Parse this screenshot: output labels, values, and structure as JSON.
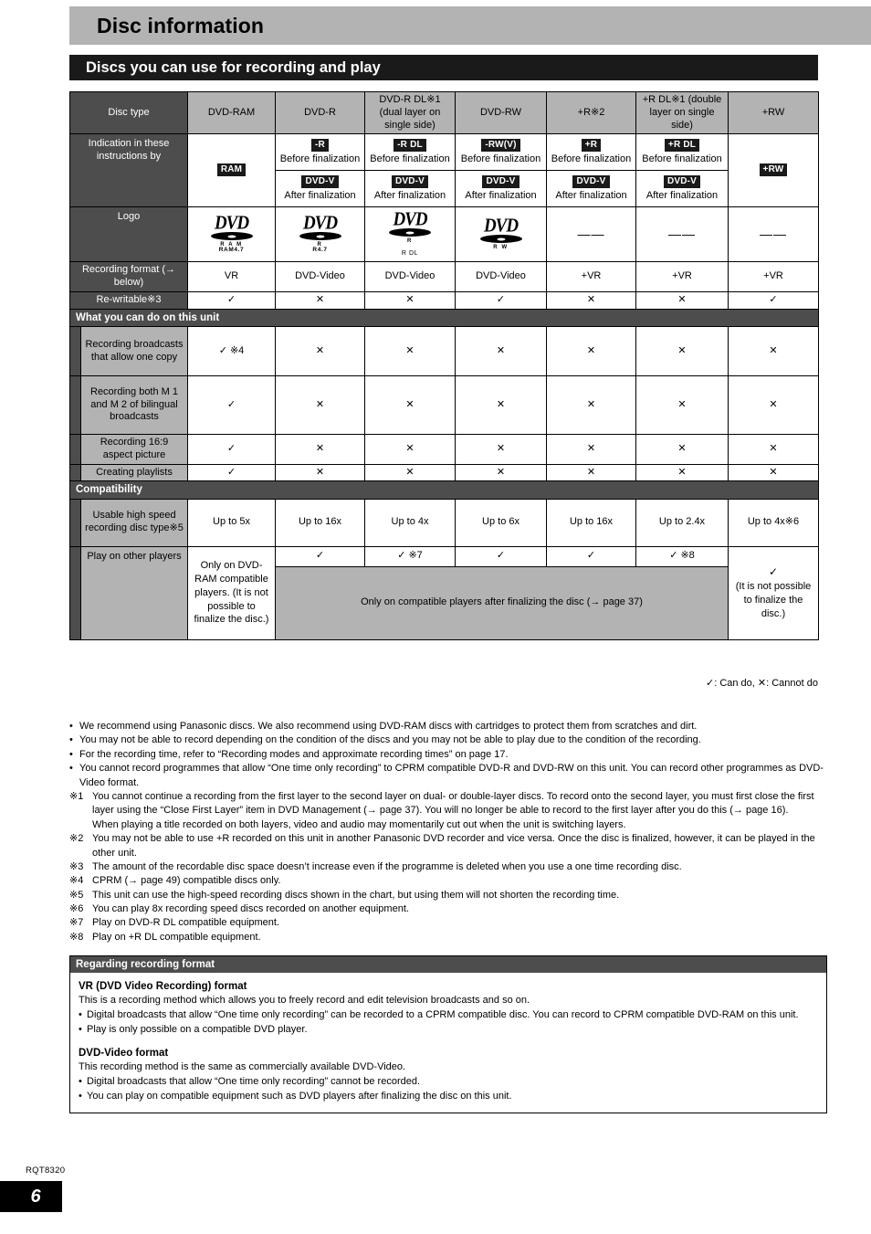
{
  "page": {
    "title": "Disc information",
    "section_title": "Discs you can use for recording and play",
    "doc_code": "RQT8320",
    "page_number": "6"
  },
  "table": {
    "row_labels": {
      "disc_type": "Disc type",
      "indication": "Indication in these instructions by",
      "logo": "Logo",
      "recording_format": "Recording format (→ below)",
      "rewritable": "Re-writable※3",
      "band_what_you_can_do": "What you can do on this unit",
      "rec_one_copy": "Recording broadcasts that allow one copy",
      "rec_bilingual": "Recording both M 1 and M 2 of bilingual broadcasts",
      "rec_169": "Recording 16:9 aspect picture",
      "creating_playlists": "Creating playlists",
      "band_compatibility": "Compatibility",
      "high_speed": "Usable high speed recording disc type※5",
      "play_other": "Play on other players"
    },
    "disc_types": [
      "DVD-RAM",
      "DVD-R",
      "DVD-R DL※1 (dual layer on single side)",
      "DVD-RW",
      "+R※2",
      "+R DL※1 (double layer on single side)",
      "+RW"
    ],
    "indication": [
      {
        "single": true,
        "chip": "RAM"
      },
      {
        "single": false,
        "before_chip": "-R",
        "before_text": "Before finalization",
        "after_chip": "DVD-V",
        "after_text": "After finalization"
      },
      {
        "single": false,
        "before_chip": "-R DL",
        "before_text": "Before finalization",
        "after_chip": "DVD-V",
        "after_text": "After finalization"
      },
      {
        "single": false,
        "before_chip": "-RW(V)",
        "before_text": "Before finalization",
        "after_chip": "DVD-V",
        "after_text": "After finalization"
      },
      {
        "single": false,
        "before_chip": "+R",
        "before_text": "Before finalization",
        "after_chip": "DVD-V",
        "after_text": "After finalization"
      },
      {
        "single": false,
        "before_chip": "+R DL",
        "before_text": "Before finalization",
        "after_chip": "DVD-V",
        "after_text": "After finalization"
      },
      {
        "single": true,
        "chip": "+RW"
      }
    ],
    "logos": [
      {
        "type": "dvd",
        "word": "DVD",
        "sub1": "R A M",
        "sub2": "RAM4.7",
        "sub3": ""
      },
      {
        "type": "dvd",
        "word": "DVD",
        "sub1": "R",
        "sub2": "R4.7",
        "sub3": ""
      },
      {
        "type": "dvd",
        "word": "DVD",
        "sub1": "R",
        "sub2": "",
        "sub3": "R DL"
      },
      {
        "type": "dvd",
        "word": "DVD",
        "sub1": "R W",
        "sub2": "",
        "sub3": ""
      },
      {
        "type": "dash",
        "text": "——"
      },
      {
        "type": "dash",
        "text": "——"
      },
      {
        "type": "dash",
        "text": "——"
      }
    ],
    "recording_format": [
      "VR",
      "DVD-Video",
      "DVD-Video",
      "DVD-Video",
      "+VR",
      "+VR",
      "+VR"
    ],
    "rewritable": [
      "✓",
      "✕",
      "✕",
      "✓",
      "✕",
      "✕",
      "✓"
    ],
    "rec_one_copy": [
      "✓ ※4",
      "✕",
      "✕",
      "✕",
      "✕",
      "✕",
      "✕"
    ],
    "rec_bilingual": [
      "✓",
      "✕",
      "✕",
      "✕",
      "✕",
      "✕",
      "✕"
    ],
    "rec_169": [
      "✓",
      "✕",
      "✕",
      "✕",
      "✕",
      "✕",
      "✕"
    ],
    "creating_playlists": [
      "✓",
      "✕",
      "✕",
      "✕",
      "✕",
      "✕",
      "✕"
    ],
    "high_speed": [
      "Up to 5x",
      "Up to 16x",
      "Up to 4x",
      "Up to 6x",
      "Up to 16x",
      "Up to 2.4x",
      "Up to 4x※6"
    ],
    "play_other": {
      "ram": "Only on DVD-RAM compatible players. (It is not possible to finalize the disc.)",
      "marks": [
        "✓",
        "✓ ※7",
        "✓",
        "✓",
        "✓ ※8"
      ],
      "merged": "Only on compatible players after finalizing the disc (→ page 37)",
      "rw_mark": "✓",
      "rw_text": "(It is not possible to finalize the disc.)"
    }
  },
  "legend": "✓: Can do, ✕: Cannot do",
  "notes": {
    "bullets": [
      "We recommend using Panasonic discs. We also recommend using DVD-RAM discs with cartridges to protect them from scratches and dirt.",
      "You may not be able to record depending on the condition of the discs and you may not be able to play due to the condition of the recording.",
      "For the recording time, refer to “Recording modes and approximate recording times” on page 17.",
      "You cannot record programmes that allow “One time only recording” to CPRM compatible DVD-R and DVD-RW on this unit. You can record other programmes as DVD-Video format."
    ],
    "numbered": [
      {
        "num": "※1",
        "lines": [
          "You cannot continue a recording from the first layer to the second layer on dual- or double-layer discs. To record onto the second layer, you must first close the first layer using the “Close First Layer” item in DVD Management (→ page 37). You will no longer be able to record to the first layer after you do this (→ page 16).",
          "When playing a title recorded on both layers, video and audio may momentarily cut out when the unit is switching layers."
        ]
      },
      {
        "num": "※2",
        "lines": [
          "You may not be able to use +R recorded on this unit in another Panasonic DVD recorder and vice versa. Once the disc is finalized, however, it can be played in the other unit."
        ]
      },
      {
        "num": "※3",
        "lines": [
          "The amount of the recordable disc space doesn’t increase even if the programme is deleted when you use a one time recording disc."
        ]
      },
      {
        "num": "※4",
        "lines": [
          "CPRM (→ page 49) compatible discs only."
        ]
      },
      {
        "num": "※5",
        "lines": [
          "This unit can use the high-speed recording discs shown in the chart, but using them will not shorten the recording time."
        ]
      },
      {
        "num": "※6",
        "lines": [
          "You can play 8x recording speed discs recorded on another equipment."
        ]
      },
      {
        "num": "※7",
        "lines": [
          "Play on DVD-R DL compatible equipment."
        ]
      },
      {
        "num": "※8",
        "lines": [
          "Play on +R DL compatible equipment."
        ]
      }
    ]
  },
  "format_box": {
    "bar": "Regarding recording format",
    "vr_heading": "VR (DVD Video Recording) format",
    "vr_intro": "This is a recording method which allows you to freely record and edit television broadcasts and so on.",
    "vr_bullets": [
      "Digital broadcasts that allow “One time only recording” can be recorded to a CPRM compatible disc. You can record to CPRM compatible DVD-RAM on this unit.",
      "Play is only possible on a compatible DVD player."
    ],
    "dv_heading": "DVD-Video format",
    "dv_intro": "This recording method is the same as commercially available DVD-Video.",
    "dv_bullets": [
      "Digital broadcasts that allow “One time only recording” cannot be recorded.",
      "You can play on compatible equipment such as DVD players after finalizing the disc on this unit."
    ]
  }
}
